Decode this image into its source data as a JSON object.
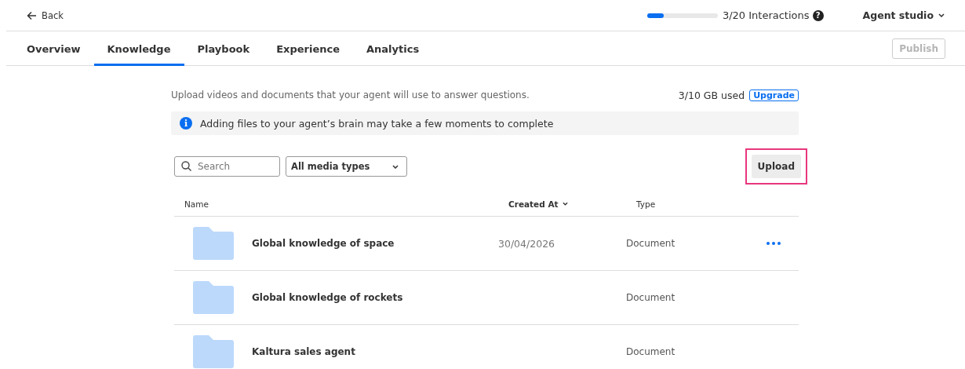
{
  "header": {
    "back": "Back",
    "usage": {
      "level": 0.23,
      "label": "3/20 Interactions",
      "help": "?"
    },
    "menu": "Agent studio"
  },
  "tabs": [
    {
      "label": "Overview",
      "selected": false
    },
    {
      "label": "Knowledge",
      "selected": true
    },
    {
      "label": "Playbook",
      "selected": false
    },
    {
      "label": "Experience",
      "selected": false
    },
    {
      "label": "Analytics",
      "selected": false
    }
  ],
  "publish": {
    "label": "Publish",
    "disabled": true
  },
  "description": "Upload videos and documents that your agent will use to answer questions.",
  "storage": {
    "used": "3/10 GB used",
    "upgrade": "Upgrade"
  },
  "notice": {
    "icon": "i",
    "text": "Adding files to your agent’s brain may take a few moments to complete"
  },
  "search": {
    "placeholder": "Search"
  },
  "filter": {
    "value": "All media types"
  },
  "upload": {
    "label": "Upload",
    "highlighted": true
  },
  "table": {
    "columns": [
      {
        "label": "Name",
        "sortable": false
      },
      {
        "label": "Created At",
        "sortable": true
      },
      {
        "label": "Type",
        "sortable": false
      }
    ],
    "rows": [
      {
        "name": "Global knowledge of space",
        "created": "30/04/2026",
        "type": "Document",
        "actions": true
      },
      {
        "name": "Global knowledge of rockets",
        "type": "Document",
        "actions": false
      },
      {
        "name": "Kaltura sales agent",
        "type": "Document",
        "actions": false
      }
    ]
  }
}
